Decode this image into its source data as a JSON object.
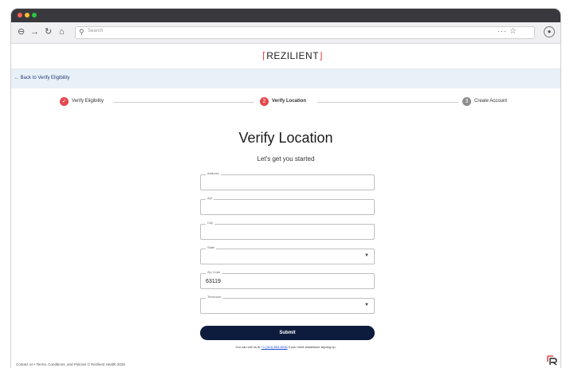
{
  "browser": {
    "search_placeholder": "Search",
    "more_label": "···",
    "colors": {
      "close": "#ff5f57",
      "minimize": "#febc2e",
      "zoom": "#28c840"
    }
  },
  "site": {
    "logo_text": "REZILIENT",
    "back_link": "Back to Verify Eligibility",
    "steps": [
      {
        "label": "Verify Eligibility",
        "state": "complete",
        "marker": "✓"
      },
      {
        "label": "Verify Location",
        "state": "current",
        "marker": "2"
      },
      {
        "label": "Create Account",
        "state": "upcoming",
        "marker": "3"
      }
    ],
    "colors": {
      "accent": "#e5484d",
      "navy": "#0d1b3d",
      "muted": "#8c8c8c"
    }
  },
  "form": {
    "title": "Verify Location",
    "subtitle": "Let's get you started",
    "fields": {
      "address": {
        "label": "Address",
        "value": ""
      },
      "apt": {
        "label": "Apt",
        "value": ""
      },
      "city": {
        "label": "City",
        "value": ""
      },
      "state": {
        "label": "State",
        "value": ""
      },
      "zip": {
        "label": "Zip Code",
        "value": "63119"
      },
      "timezone": {
        "label": "Timezone",
        "value": ""
      }
    },
    "submit_label": "Submit",
    "help_prefix": "You can call us at ",
    "help_phone": "+1 (314) 853-6236",
    "help_suffix": " if you need assistance signing up."
  },
  "footer": {
    "contact": "Contact us",
    "separator": "•",
    "terms": "Terms, Conditions, and Policies",
    "copyright": "© Rezilient Health 2026"
  }
}
